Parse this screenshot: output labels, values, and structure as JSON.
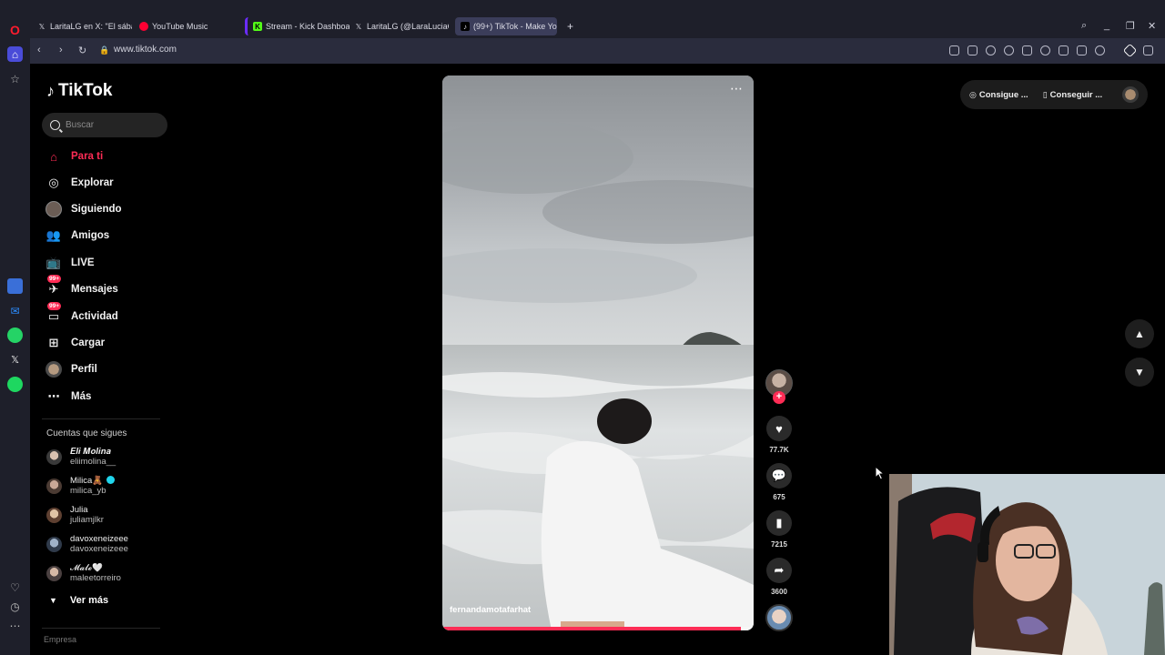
{
  "browser": {
    "tabs": [
      {
        "label": "LaritaLG en X: \"El sábado l",
        "favicon": "x-icon",
        "active": false
      },
      {
        "label": "YouTube Music",
        "favicon": "youtube-music-icon",
        "active": false
      },
      {
        "label": "Stream - Kick Dashboard",
        "favicon": "kick-icon",
        "active": false
      },
      {
        "label": "LaritaLG (@LaraLuciaGarc",
        "favicon": "x-icon",
        "active": false
      },
      {
        "label": "(99+) TikTok - Make Yo",
        "favicon": "tiktok-icon",
        "active": true
      }
    ],
    "url": "www.tiktok.com"
  },
  "sidebar": {
    "logo": "TikTok",
    "search_placeholder": "Buscar",
    "menu": [
      {
        "label": "Para ti",
        "icon": "home-icon",
        "active": true
      },
      {
        "label": "Explorar",
        "icon": "compass-icon"
      },
      {
        "label": "Siguiendo",
        "icon": "following-avatar-icon"
      },
      {
        "label": "Amigos",
        "icon": "friends-icon"
      },
      {
        "label": "LIVE",
        "icon": "live-icon"
      },
      {
        "label": "Mensajes",
        "icon": "messages-icon",
        "badge": "99+"
      },
      {
        "label": "Actividad",
        "icon": "activity-icon",
        "badge": "99+"
      },
      {
        "label": "Cargar",
        "icon": "upload-icon"
      },
      {
        "label": "Perfil",
        "icon": "profile-avatar-icon"
      },
      {
        "label": "Más",
        "icon": "more-icon"
      }
    ],
    "following_title": "Cuentas que sigues",
    "following": [
      {
        "name": "𝑬𝒍𝒊 𝑴𝒐𝒍𝒊𝒏𝒂",
        "handle": "eliimolina__",
        "verified": false
      },
      {
        "name": "Milica🧸",
        "handle": "milica_yb",
        "verified": true
      },
      {
        "name": "Julia",
        "handle": "juliamjlkr",
        "verified": false
      },
      {
        "name": "davoxeneizeee",
        "handle": "davoxeneizeee",
        "verified": false
      },
      {
        "name": "𝓜𝓪𝓵𝓮🤍",
        "handle": "maleetorreiro",
        "verified": false
      }
    ],
    "see_more": "Ver más",
    "company": "Empresa"
  },
  "video": {
    "author": "fernandamotafarhat",
    "progress": 0.96
  },
  "actions": {
    "likes": "77.7K",
    "comments": "675",
    "saves": "7215",
    "shares": "3600"
  },
  "topbar": {
    "coins_label": "Consigue ...",
    "app_label": "Conseguir ..."
  }
}
